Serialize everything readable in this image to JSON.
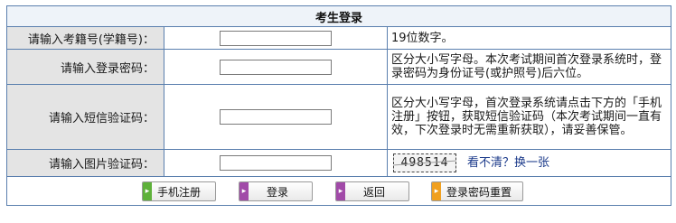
{
  "title": "考生登录",
  "rows": [
    {
      "label": "请输入考籍号(学籍号)：",
      "hint": "19位数字。"
    },
    {
      "label": "请输入登录密码：",
      "hint": "区分大小写字母。本次考试期间首次登录系统时，登录密码为身份证号(或护照号)后六位。"
    },
    {
      "label": "请输入短信验证码：",
      "hint": "区分大小写字母，首次登录系统请点击下方的「手机注册」按钮，获取短信验证码（本次考试期间一直有效，下次登录时无需重新获取），请妥善保管。"
    },
    {
      "label": "请输入图片验证码：",
      "captcha": "498514",
      "refresh": "看不清？换一张"
    }
  ],
  "buttons": {
    "register": "手机注册",
    "login": "登录",
    "back": "返回",
    "reset": "登录密码重置"
  },
  "colors": {
    "border": "#5a7fae",
    "label_bg": "#e4e4e4",
    "title_bg": "#eef3f9",
    "link": "#1b3a8a"
  },
  "icons": {
    "button_arrow": "triangle-right-icon"
  }
}
